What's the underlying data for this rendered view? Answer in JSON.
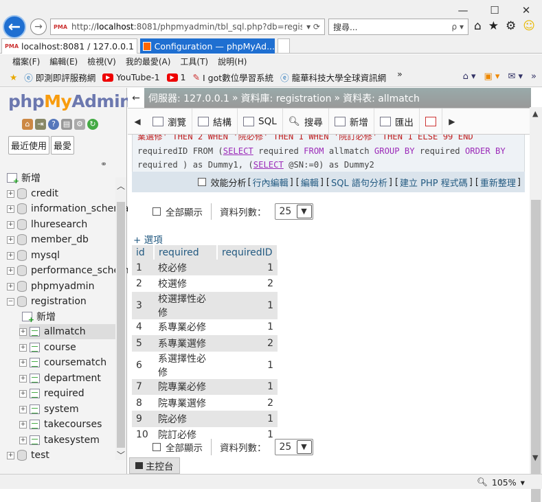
{
  "browser": {
    "address_prefix": "http://",
    "address_host": "localhost",
    "address_rest": ":8081/phpmyadmin/tbl_sql.php?db=registr",
    "address_controls": "▾ ⟳",
    "search_placeholder": "搜尋...",
    "search_controls": "ρ ▾",
    "tabs": [
      {
        "label": "localhost:8081 / 127.0.0.1 ...",
        "close": "✕"
      },
      {
        "label": "Configuration — phpMyAd..."
      }
    ],
    "menu": [
      "檔案(F)",
      "編輯(E)",
      "檢視(V)",
      "我的最愛(A)",
      "工具(T)",
      "說明(H)"
    ],
    "favorites": [
      {
        "label": "即測即評服務網"
      },
      {
        "label": "YouTube-1"
      },
      {
        "label": "1"
      },
      {
        "label": "I got數位學習系統"
      },
      {
        "label": "龍華科技大學全球資訊網"
      }
    ],
    "favorites_more": "»",
    "zoom": "105%"
  },
  "sidebar": {
    "logo_php": "php",
    "logo_my": "My",
    "logo_admin": "Admin",
    "recent_label": "最近使用",
    "favorites_label": "最愛",
    "new_label": "新增",
    "databases": [
      "credit",
      "information_schema",
      "lhuresearch",
      "member_db",
      "mysql",
      "performance_schema",
      "phpmyadmin",
      "registration",
      "test"
    ],
    "reg_new": "新增",
    "tables": [
      "allmatch",
      "course",
      "coursematch",
      "department",
      "required",
      "system",
      "takecourses",
      "takesystem"
    ],
    "expand_plus": "+",
    "expand_minus": "−"
  },
  "breadcrumb": {
    "back": "←",
    "server": "伺服器: 127.0.0.1",
    "database": "資料庫: registration",
    "table": "資料表: allmatch",
    "sep": "»"
  },
  "tabbar": {
    "prev": "◀",
    "next": "▶",
    "items": [
      "瀏覽",
      "結構",
      "SQL",
      "搜尋",
      "新增",
      "匯出"
    ]
  },
  "sql": {
    "line1": "業選修' THEN 2 WHEN '院必修' THEN 1 WHEN '院訂必修' THEN 1 ELSE 99 END",
    "line2_a": "requiredID FROM (",
    "line2_b": "SELECT",
    "line2_c": " required ",
    "line2_d": "FROM",
    "line2_e": " allmatch ",
    "line2_f": "GROUP BY",
    "line2_g": " required ",
    "line2_h": "ORDER BY",
    "line3_a": "required ) as Dummy1, (",
    "line3_b": "SELECT",
    "line3_c": " @SN:=0) as Dummy2"
  },
  "links": {
    "profiling": "效能分析",
    "inline_edit": "行內編輯",
    "edit": "編輯",
    "explain": "SQL 語句分析",
    "create_php": "建立 PHP 程式碼",
    "refresh": "重新整理",
    "lb": "[",
    "rb": "]"
  },
  "controls": {
    "show_all": "全部顯示",
    "rows_label": "資料列數：",
    "rows_value": "25",
    "dropdown": "▼"
  },
  "options_link": "+ 選項",
  "table": {
    "headers": [
      "id",
      "required",
      "requiredID"
    ],
    "rows": [
      [
        "1",
        "校必修",
        "1"
      ],
      [
        "2",
        "校選修",
        "2"
      ],
      [
        "3",
        "校選擇性必修",
        "1"
      ],
      [
        "4",
        "系專業必修",
        "1"
      ],
      [
        "5",
        "系專業選修",
        "2"
      ],
      [
        "6",
        "系選擇性必修",
        "1"
      ],
      [
        "7",
        "院專業必修",
        "1"
      ],
      [
        "8",
        "院專業選修",
        "2"
      ],
      [
        "9",
        "院必修",
        "1"
      ],
      [
        "10",
        "院訂必修",
        "1"
      ]
    ]
  },
  "console_label": "主控台"
}
